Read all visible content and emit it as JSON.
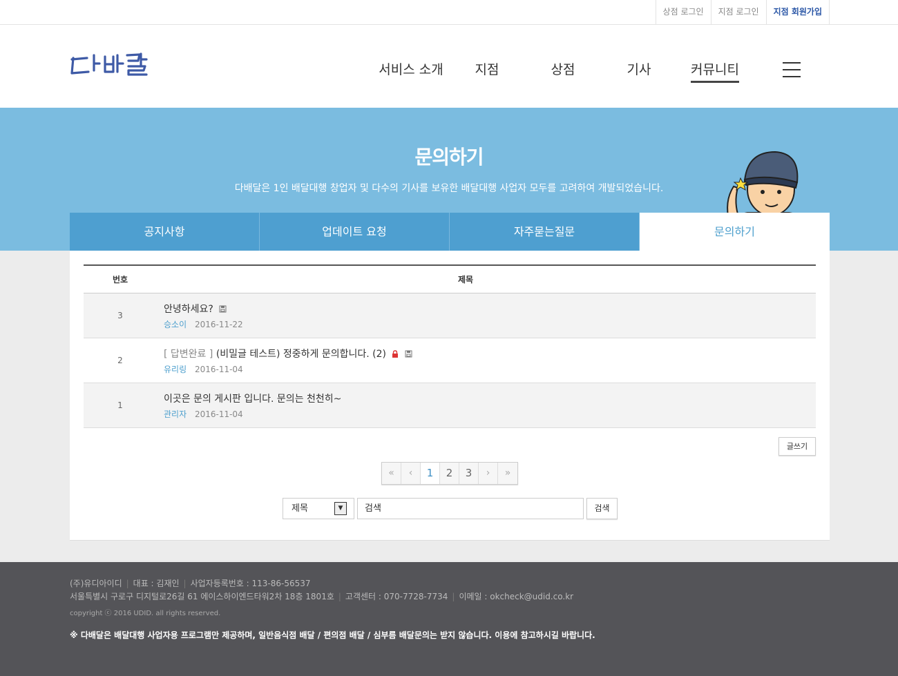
{
  "util_nav": {
    "store_login": "상점 로그인",
    "branch_login": "지점 로그인",
    "branch_signup": "지점 회원가입"
  },
  "logo_text": "다배달",
  "gnb": {
    "service": "서비스 소개",
    "branch": "지점",
    "store": "상점",
    "driver": "기사",
    "community": "커뮤니티"
  },
  "hero": {
    "title": "문의하기",
    "subtitle": "다배달은 1인 배달대행 창업자 및 다수의 기사를 보유한 배달대행 사업자 모두를 고려하여 개발되었습니다."
  },
  "tabs": [
    "공지사항",
    "업데이트 요청",
    "자주묻는질문",
    "문의하기"
  ],
  "board": {
    "col_num": "번호",
    "col_title": "제목",
    "rows": [
      {
        "num": "3",
        "tag": "",
        "title": "안녕하세요?",
        "author": "승소이",
        "date": "2016-11-22"
      },
      {
        "num": "2",
        "tag": "[ 답변완료 ]",
        "title": "(비밀글 테스트) 정중하게 문의합니다. (2)",
        "author": "유리링",
        "date": "2016-11-04"
      },
      {
        "num": "1",
        "tag": "",
        "title": "이곳은 문의 게시판 입니다. 문의는 천천히~",
        "author": "관리자",
        "date": "2016-11-04"
      }
    ]
  },
  "write_label": "글쓰기",
  "pager": {
    "first": "«",
    "prev": "‹",
    "pages": [
      "1",
      "2",
      "3"
    ],
    "current": "1",
    "next": "›",
    "last": "»"
  },
  "search": {
    "field": "제목",
    "placeholder": "검색",
    "button": "검색"
  },
  "footer": {
    "company": "(주)유디아이디",
    "ceo": "대표 : 김재인",
    "biz_no": "사업자등록번호 : 113-86-56537",
    "address": "서울특별시 구로구 디지털로26길 61 에이스하이엔드타워2차 18층 1801호",
    "cs": "고객센터 : 070-7728-7734",
    "email": "이메일 : okcheck@udid.co.kr",
    "copyright": "copyright ⓒ 2016 UDID. all rights reserved.",
    "notice": "※ 다배달은 배달대행 사업자용 프로그램만 제공하며, 일반음식점 배달 / 편의점 배달 / 심부름 배달문의는 받지 않습니다. 이용에 참고하시길 바랍니다."
  },
  "colors": {
    "hero_bg": "#7bbce0",
    "tab_bg": "#4e9fd0",
    "accent": "#4d9fcd",
    "footer_bg": "#545458"
  }
}
